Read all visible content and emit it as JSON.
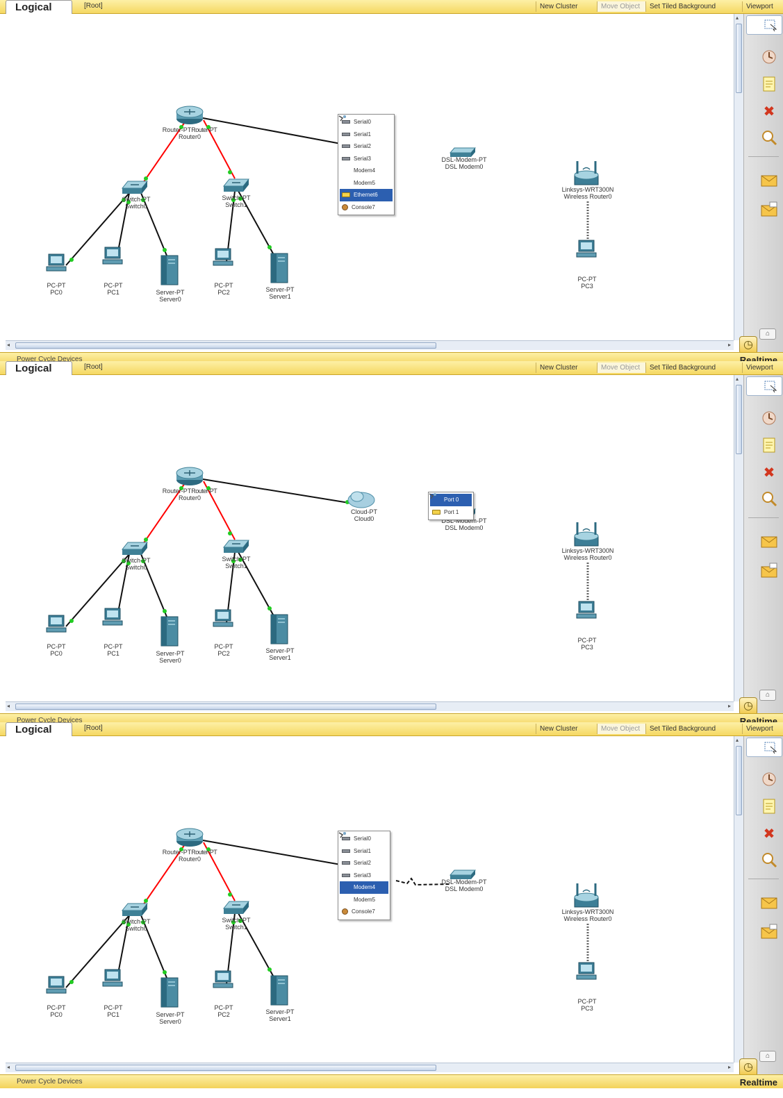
{
  "colors": {
    "toolbar_yellow": "#f5d862",
    "straight_through_cable": "#000000",
    "crossover_cable": "#ff0000",
    "link_light_up": "#22cc22",
    "selection_blue": "#2c5fb0"
  },
  "toolbar": {
    "logical_tab": "Logical",
    "root": "[Root]",
    "new_cluster": "New Cluster",
    "move_object": "Move Object",
    "set_tiled_background": "Set Tiled Background",
    "viewport": "Viewport"
  },
  "status_bar": {
    "power_cycle": "Power Cycle Devices",
    "mode": "Realtime"
  },
  "side_tools": [
    "select-tool-icon",
    "inspect-icon",
    "note-icon",
    "delete-icon",
    "zoom-icon",
    "simple-pdu-icon",
    "complex-pdu-icon"
  ],
  "devices": {
    "router": {
      "model": "Router-PT",
      "name": "Router0",
      "model_overlap": "Router-PT",
      "name_overlap": "Router0"
    },
    "switch0": {
      "model": "Switch-PT",
      "name": "Switch0"
    },
    "switch1": {
      "model": "Switch-PT",
      "name": "Switch1"
    },
    "pc0": {
      "model": "PC-PT",
      "name": "PC0"
    },
    "pc1": {
      "model": "PC-PT",
      "name": "PC1"
    },
    "server0": {
      "model": "Server-PT",
      "name": "Server0"
    },
    "pc2": {
      "model": "PC-PT",
      "name": "PC2"
    },
    "server1": {
      "model": "Server-PT",
      "name": "Server1"
    },
    "dsl_modem": {
      "model": "DSL-Modem-PT",
      "name": "DSL Modem0"
    },
    "wireless_router": {
      "model": "Linksys-WRT300N",
      "name": "Wireless Router0"
    },
    "pc3": {
      "model": "PC-PT",
      "name": "PC3"
    },
    "cloud": {
      "model": "Cloud-PT",
      "name": "Cloud0"
    }
  },
  "panels": [
    {
      "menu": {
        "items": [
          {
            "label": "Serial0",
            "icon": "serial-port-icon",
            "selected": false
          },
          {
            "label": "Serial1",
            "icon": "serial-port-icon",
            "selected": false
          },
          {
            "label": "Serial2",
            "icon": "serial-port-icon",
            "selected": false
          },
          {
            "label": "Serial3",
            "icon": "serial-port-icon",
            "selected": false
          },
          {
            "label": "Modem4",
            "icon": "modem-port-icon",
            "selected": false
          },
          {
            "label": "Modem5",
            "icon": "modem-port-icon",
            "selected": false
          },
          {
            "label": "Ethernet6",
            "icon": "ethernet-port-icon",
            "selected": true
          },
          {
            "label": "Console7",
            "icon": "console-port-icon",
            "selected": false
          }
        ]
      }
    },
    {
      "menu": {
        "items": [
          {
            "label": "Port 0",
            "icon": "modem-port-icon",
            "selected": true
          },
          {
            "label": "Port 1",
            "icon": "ethernet-port-icon",
            "selected": false
          }
        ]
      }
    },
    {
      "menu": {
        "items": [
          {
            "label": "Serial0",
            "icon": "serial-port-icon",
            "selected": false
          },
          {
            "label": "Serial1",
            "icon": "serial-port-icon",
            "selected": false
          },
          {
            "label": "Serial2",
            "icon": "serial-port-icon",
            "selected": false
          },
          {
            "label": "Serial3",
            "icon": "serial-port-icon",
            "selected": false
          },
          {
            "label": "Modem4",
            "icon": "modem-port-icon",
            "selected": true
          },
          {
            "label": "Modem5",
            "icon": "modem-port-icon",
            "selected": false
          },
          {
            "label": "Console7",
            "icon": "console-port-icon",
            "selected": false
          }
        ]
      }
    }
  ]
}
